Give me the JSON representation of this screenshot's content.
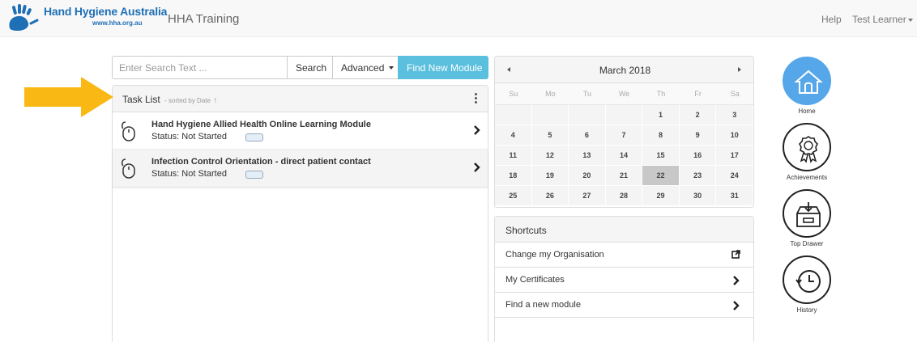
{
  "navbar": {
    "logo_text": "Hand Hygiene Australia",
    "logo_url": "www.hha.org.au",
    "title": "HHA Training",
    "help": "Help",
    "user": "Test Learner"
  },
  "search": {
    "placeholder": "Enter Search Text ...",
    "search_label": "Search",
    "advanced_label": "Advanced",
    "find_label": "Find New Module"
  },
  "tasks": {
    "title": "Task List",
    "sorted_by": "- sorted by Date",
    "items": [
      {
        "name": "Hand Hygiene Allied Health Online Learning Module",
        "status": "Status: Not Started"
      },
      {
        "name": "Infection Control Orientation - direct patient contact",
        "status": "Status: Not Started"
      }
    ]
  },
  "calendar": {
    "month": "March 2018",
    "weekdays": [
      "Su",
      "Mo",
      "Tu",
      "We",
      "Th",
      "Fr",
      "Sa"
    ],
    "leading_blanks": 4,
    "days_in_month": 31,
    "today": 22
  },
  "shortcuts": {
    "title": "Shortcuts",
    "items": [
      {
        "label": "Change my Organisation",
        "icon": "external-link-icon"
      },
      {
        "label": "My Certificates",
        "icon": "chevron-right-icon"
      },
      {
        "label": "Find a new module",
        "icon": "chevron-right-icon"
      }
    ]
  },
  "right_nav": [
    {
      "label": "Home",
      "icon": "home-icon",
      "active": true
    },
    {
      "label": "Achievements",
      "icon": "ribbon-icon",
      "active": false
    },
    {
      "label": "Top Drawer",
      "icon": "drawer-icon",
      "active": false
    },
    {
      "label": "History",
      "icon": "history-icon",
      "active": false
    }
  ],
  "colors": {
    "brand_blue": "#1f6fb7",
    "find_button": "#5bc0de",
    "home_active": "#56a7e9",
    "arrow": "#f9b814",
    "today_cell": "#c8c8c8"
  }
}
